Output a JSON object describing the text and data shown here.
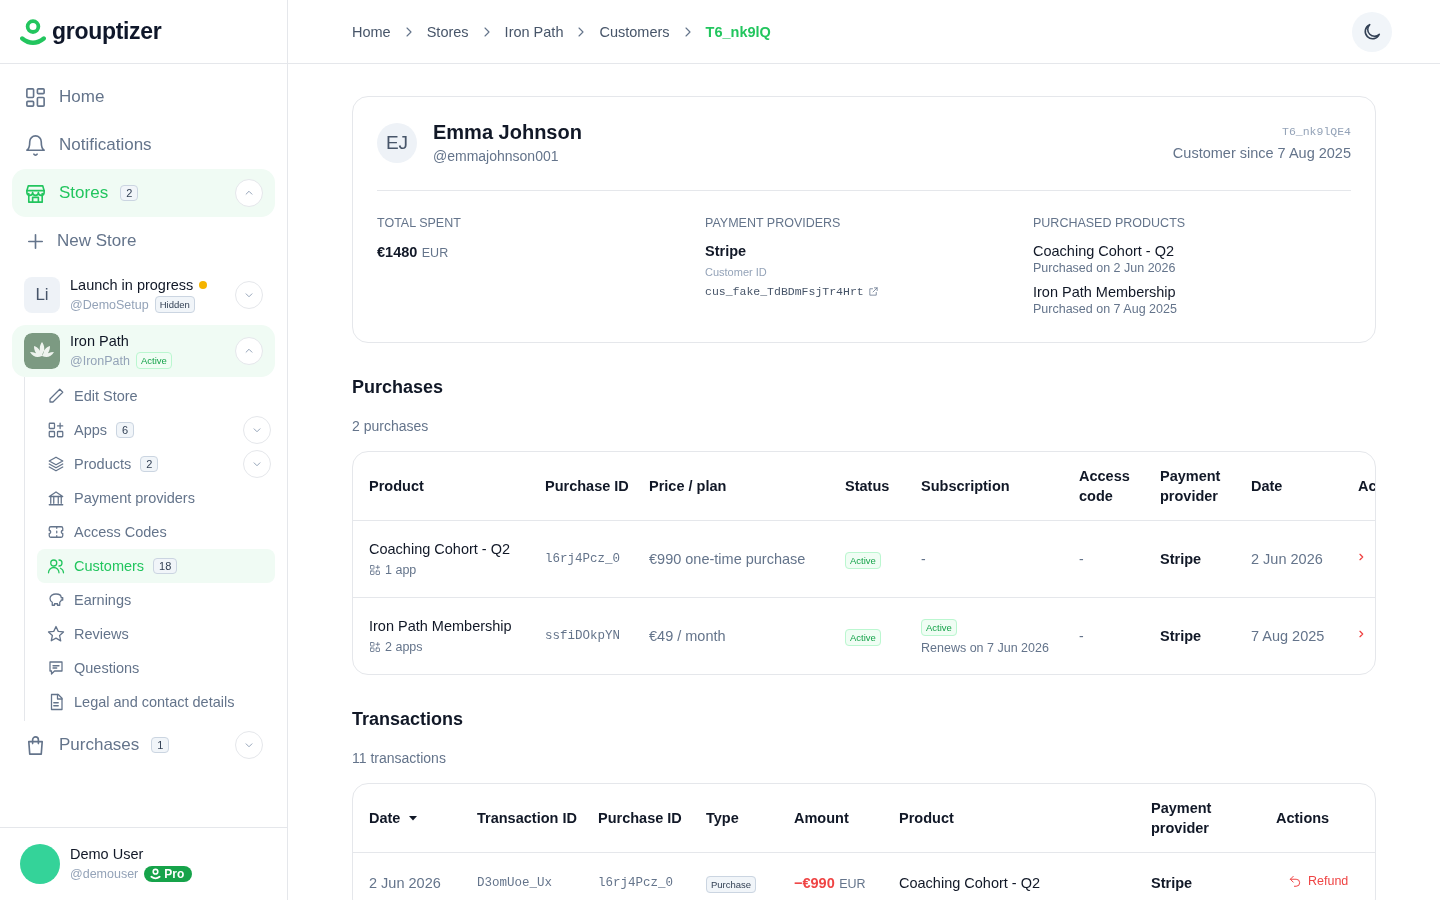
{
  "logo": {
    "text": "grouptizer"
  },
  "sidebar": {
    "nav": [
      {
        "label": "Home",
        "selected": false
      },
      {
        "label": "Notifications",
        "selected": false
      },
      {
        "label": "Stores",
        "badge": "2",
        "selected": true,
        "expanded": true
      }
    ],
    "new_store": "New Store",
    "stores": [
      {
        "kind": "initials",
        "avatar": "Li",
        "name": "Launch in progress",
        "pending": true,
        "handle": "@DemoSetup",
        "status": "Hidden",
        "status_active": false,
        "selected": false,
        "expanded": false
      },
      {
        "kind": "logo",
        "name": "Iron Path",
        "pending": false,
        "handle": "@IronPath",
        "status": "Active",
        "status_active": true,
        "selected": true,
        "expanded": true
      }
    ],
    "store_menu": [
      {
        "label": "Edit Store",
        "selected": false
      },
      {
        "label": "Apps",
        "badge": "6",
        "expanded": false,
        "selected": false
      },
      {
        "label": "Products",
        "badge": "2",
        "expanded": false,
        "selected": false
      },
      {
        "label": "Payment providers",
        "selected": false
      },
      {
        "label": "Access Codes",
        "selected": false
      },
      {
        "label": "Customers",
        "badge": "18",
        "selected": true
      },
      {
        "label": "Earnings",
        "selected": false
      },
      {
        "label": "Reviews",
        "selected": false
      },
      {
        "label": "Questions",
        "selected": false
      },
      {
        "label": "Legal and contact details",
        "selected": false
      }
    ],
    "purchases": {
      "label": "Purchases",
      "badge": "1",
      "expanded": false
    },
    "user": {
      "name": "Demo User",
      "handle": "@demouser",
      "plan": "Pro"
    }
  },
  "breadcrumb": [
    {
      "label": "Home",
      "selected": false
    },
    {
      "label": "Stores",
      "selected": false
    },
    {
      "label": "Iron Path",
      "selected": false
    },
    {
      "label": "Customers",
      "selected": false
    },
    {
      "label": "T6_nk9lQ",
      "selected": true
    }
  ],
  "customer": {
    "initials": "EJ",
    "name": "Emma Johnson",
    "handle": "@emmajohnson001",
    "id": "T6_nk9lQE4",
    "since": "Customer since 7 Aug 2025",
    "total_spent": {
      "label": "TOTAL SPENT",
      "amount": "€1480",
      "currency": "EUR"
    },
    "payment_providers": {
      "label": "PAYMENT PROVIDERS",
      "name": "Stripe",
      "id_label": "Customer ID",
      "id": "cus_fake_TdBDmFsjTr4Hrt"
    },
    "purchased_products": {
      "label": "PURCHASED PRODUCTS",
      "items": [
        {
          "name": "Coaching Cohort - Q2",
          "date": "Purchased on 2 Jun 2026"
        },
        {
          "name": "Iron Path Membership",
          "date": "Purchased on 7 Aug 2025"
        }
      ]
    }
  },
  "purchases": {
    "title": "Purchases",
    "count": "2 purchases",
    "columns": [
      "Product",
      "Purchase ID",
      "Price / plan",
      "Status",
      "Subscription",
      "Access code",
      "Payment provider",
      "Date",
      "Ac"
    ],
    "rows": [
      {
        "product": "Coaching Cohort - Q2",
        "apps": "1 app",
        "purchase_id": "l6rj4Pcz_0",
        "price": "€990 one-time purchase",
        "status": "Active",
        "subscription": null,
        "subscription_empty": "-",
        "access_code": "-",
        "provider": "Stripe",
        "date": "2 Jun 2026"
      },
      {
        "product": "Iron Path Membership",
        "apps": "2 apps",
        "purchase_id": "ssfiDOkpYN",
        "price": "€49 / month",
        "status": "Active",
        "subscription": {
          "status": "Active",
          "renews": "Renews on 7 Jun 2026"
        },
        "access_code": "-",
        "provider": "Stripe",
        "date": "7 Aug 2025"
      }
    ]
  },
  "transactions": {
    "title": "Transactions",
    "count": "11 transactions",
    "columns": [
      {
        "label": "Date",
        "sorted": true
      },
      {
        "label": "Transaction ID",
        "sorted": false
      },
      {
        "label": "Purchase ID",
        "sorted": false
      },
      {
        "label": "Type",
        "sorted": false
      },
      {
        "label": "Amount",
        "sorted": false
      },
      {
        "label": "Product",
        "sorted": false
      },
      {
        "label": "Payment provider",
        "sorted": false
      },
      {
        "label": "Actions",
        "sorted": false
      }
    ],
    "rows": [
      {
        "date": "2 Jun 2026",
        "transaction_id": "D3omUoe_Ux",
        "purchase_id": "l6rj4Pcz_0",
        "type": "Purchase",
        "amount": "−€990",
        "currency": "EUR",
        "product": "Coaching Cohort - Q2",
        "provider": "Stripe",
        "action": "Refund"
      }
    ]
  }
}
